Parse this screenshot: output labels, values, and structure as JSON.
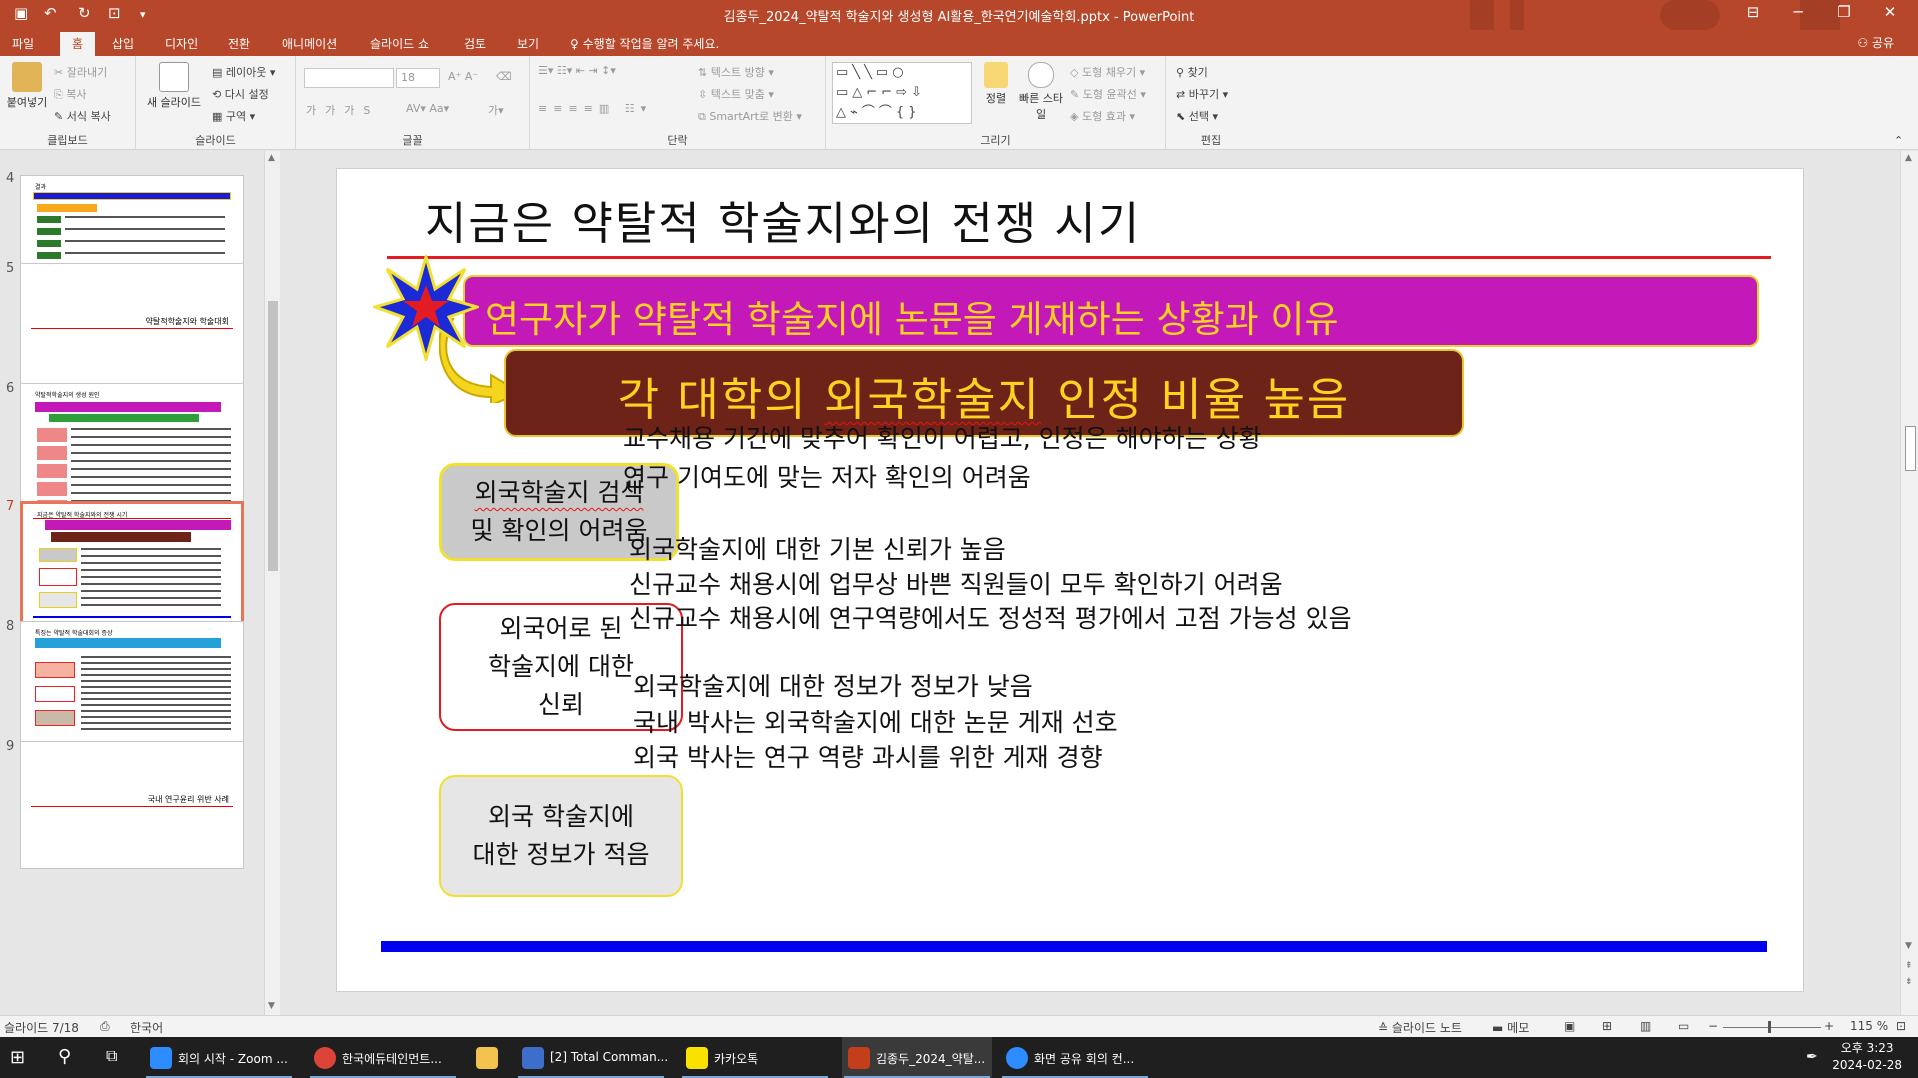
{
  "app": {
    "window_title": "김종두_2024_약탈적 학술지와 생성형 AI활용_한국연기예술학회.pptx - PowerPoint",
    "share_label": "공유",
    "tell_me": "수행할 작업을 알려 주세요."
  },
  "tabs": [
    "파일",
    "홈",
    "삽입",
    "디자인",
    "전환",
    "애니메이션",
    "슬라이드 쇼",
    "검토",
    "보기"
  ],
  "ribbon": {
    "clipboard": {
      "label": "클립보드",
      "paste": "붙여넣기",
      "cut": "잘라내기",
      "copy": "복사",
      "format_painter": "서식 복사"
    },
    "slides": {
      "label": "슬라이드",
      "new_slide": "새 슬라이드",
      "layout": "레이아웃",
      "reset": "다시 설정",
      "section": "구역"
    },
    "font": {
      "label": "글꼴",
      "size": "18"
    },
    "paragraph": {
      "label": "단락",
      "text_direction": "텍스트 방향",
      "align_text": "텍스트 맞춤",
      "smartart": "SmartArt로 변환"
    },
    "drawing": {
      "label": "그리기",
      "arrange": "정렬",
      "quick_styles": "빠른 스타일",
      "shape_fill": "도형 채우기",
      "shape_outline": "도형 윤곽선",
      "shape_effects": "도형 효과"
    },
    "editing": {
      "label": "편집",
      "find": "찾기",
      "replace": "바꾸기",
      "select": "선택"
    }
  },
  "thumbnails": [
    {
      "num": "4",
      "title": "결과"
    },
    {
      "num": "5",
      "title": "약탈적학술지와 학술대회"
    },
    {
      "num": "6",
      "title": "약탈적학술지의 생성 원인"
    },
    {
      "num": "7",
      "title": "지금은 약탈적 학술지와의 전쟁 시기",
      "active": true
    },
    {
      "num": "8",
      "title": "특징는 약탈적 학술대회의 증상"
    },
    {
      "num": "9",
      "title": "국내 연구윤리 위반 사례"
    }
  ],
  "slide": {
    "title": "지금은 약탈적 학술지와의 전쟁 시기",
    "banner": "연구자가 약탈적 학술지에 논문을 게재하는 상황과 이유",
    "headline_pre": "각 대학의 ",
    "headline_underlined": "외국학술지",
    "headline_post": " 인정 비율 높음",
    "rows": [
      {
        "box_line1": "외국학술지 검색",
        "box_line2": "및 확인의 어려움",
        "lines": [
          "교수채용 기간에 맞추어 확인이 어렵고, 인정은 해야하는 상황",
          "연구 기여도에 맞는 저자 확인의 어려움"
        ]
      },
      {
        "box_line1": "외국어로 된",
        "box_line2": "학술지에 대한",
        "box_line3": "신뢰",
        "lines": [
          "외국학술지에 대한 기본 신뢰가 높음",
          "신규교수 채용시에 업무상 바쁜 직원들이 모두 확인하기 어려움",
          "신규교수 채용시에 연구역량에서도 정성적 평가에서 고점 가능성 있음"
        ]
      },
      {
        "box_line1": "외국 학술지에",
        "box_line2": "대한 정보가 적음",
        "lines": [
          "외국학술지에 대한 정보가 정보가 낮음",
          "국내 박사는 외국학술지에 대한 논문 게재 선호",
          "외국 박사는 연구 역량 과시를 위한 게재 경향"
        ]
      }
    ]
  },
  "status": {
    "slide_pos": "슬라이드 7/18",
    "language": "한국어",
    "notes": "슬라이드 노트",
    "comments": "메모",
    "zoom": "115 %"
  },
  "taskbar": {
    "items": [
      {
        "label": "회의 시작 - Zoom ...",
        "color": "#2d8cff"
      },
      {
        "label": "한국에듀테인먼트...",
        "color": "#db4437"
      },
      {
        "label": "",
        "color": "#f2c14e"
      },
      {
        "label": "[2] Total Comman...",
        "color": "#3d6ec9"
      },
      {
        "label": "카카오톡",
        "color": "#fae100"
      },
      {
        "label": "김종두_2024_약탈...",
        "color": "#c43e1c"
      },
      {
        "label": "화면 공유 회의 컨...",
        "color": "#2d8cff"
      }
    ],
    "time": "오후 3:23",
    "date": "2024-02-28"
  }
}
